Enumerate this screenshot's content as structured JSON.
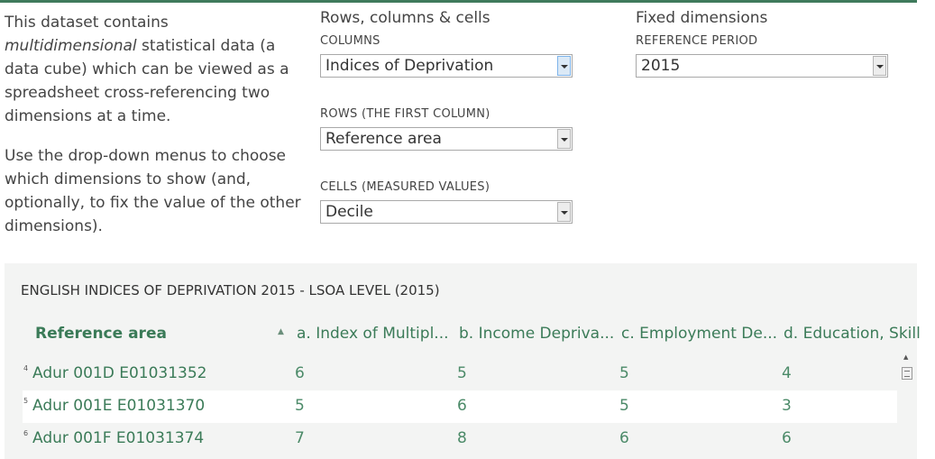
{
  "intro": {
    "p1_before": "This dataset contains ",
    "p1_em": "multidimensional",
    "p1_after": " statistical data (a data cube) which can be viewed as a spreadsheet cross-referencing two dimensions at a time.",
    "p2": "Use the drop-down menus to choose which dimensions to show (and, optionally, to fix the value of the other dimensions)."
  },
  "rcc": {
    "heading": "Rows, columns & cells",
    "columns_label": "COLUMNS",
    "columns_value": "Indices of Deprivation",
    "rows_label": "ROWS (THE FIRST COLUMN)",
    "rows_value": "Reference area",
    "cells_label": "CELLS (MEASURED VALUES)",
    "cells_value": "Decile"
  },
  "fixed": {
    "heading": "Fixed dimensions",
    "period_label": "REFERENCE PERIOD",
    "period_value": "2015"
  },
  "grid": {
    "title": "ENGLISH INDICES OF DEPRIVATION 2015 - LSOA LEVEL (2015)",
    "sort_indicator": "▲",
    "headers": [
      "Reference area",
      "a. Index of Multipl...",
      "b. Income Depriva...",
      "c. Employment De...",
      "d. Education, Skill"
    ],
    "rows": [
      {
        "num": "4",
        "area": "Adur 001D E01031352",
        "a": "6",
        "b": "5",
        "c": "5",
        "d": "4"
      },
      {
        "num": "5",
        "area": "Adur 001E E01031370",
        "a": "5",
        "b": "6",
        "c": "5",
        "d": "3"
      },
      {
        "num": "6",
        "area": "Adur 001F E01031374",
        "a": "7",
        "b": "8",
        "c": "6",
        "d": "6"
      }
    ]
  },
  "colors": {
    "accent": "#3f7a5c",
    "link": "#3b7b58",
    "panel": "#f3f4f3"
  }
}
